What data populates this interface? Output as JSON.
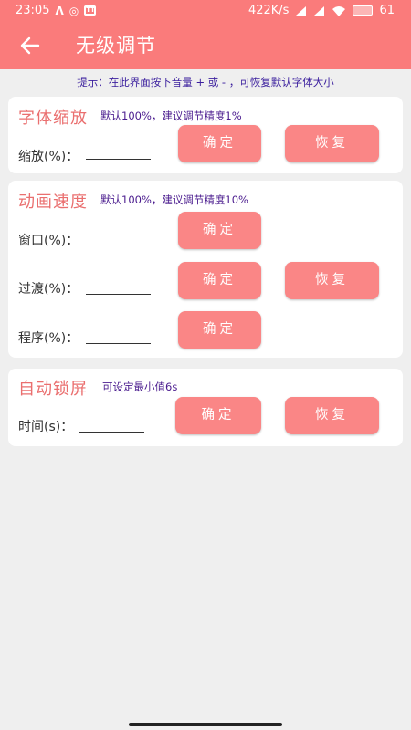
{
  "status_bar": {
    "time": "23:05",
    "net_speed": "422K/s",
    "battery": "61",
    "icons": [
      "a-logo-icon",
      "sync-icon",
      "tt-icon",
      "signal-icon",
      "signal-icon",
      "wifi-icon",
      "battery-icon"
    ]
  },
  "app_bar": {
    "title": "无级调节",
    "back_icon": "arrow-left-icon"
  },
  "hint": "提示：在此界面按下音量 + 或 - ，可恢复默认字体大小",
  "font_scale": {
    "title": "字体缩放",
    "note": "默认100%，建议调节精度1%",
    "label": "缩放(%)：",
    "input_value": "",
    "confirm_label": "确定",
    "reset_label": "恢复"
  },
  "animation_speed": {
    "title": "动画速度",
    "note": "默认100%，建议调节精度10%",
    "rows": [
      {
        "label": "窗口(%)：",
        "input_value": "",
        "confirm_label": "确定"
      },
      {
        "label": "过渡(%)：",
        "input_value": "",
        "confirm_label": "确定"
      },
      {
        "label": "程序(%)：",
        "input_value": "",
        "confirm_label": "确定"
      }
    ],
    "reset_label": "恢复"
  },
  "auto_lock": {
    "title": "自动锁屏",
    "note": "可设定最小值6s",
    "label": "时间(s)：",
    "input_value": "",
    "confirm_label": "确定",
    "reset_label": "恢复"
  },
  "colors": {
    "accent": "#fa7b7b",
    "button": "#fa8686",
    "card_title": "#ea6f6f",
    "note_text": "#4a1b8e",
    "background": "#efefef"
  }
}
